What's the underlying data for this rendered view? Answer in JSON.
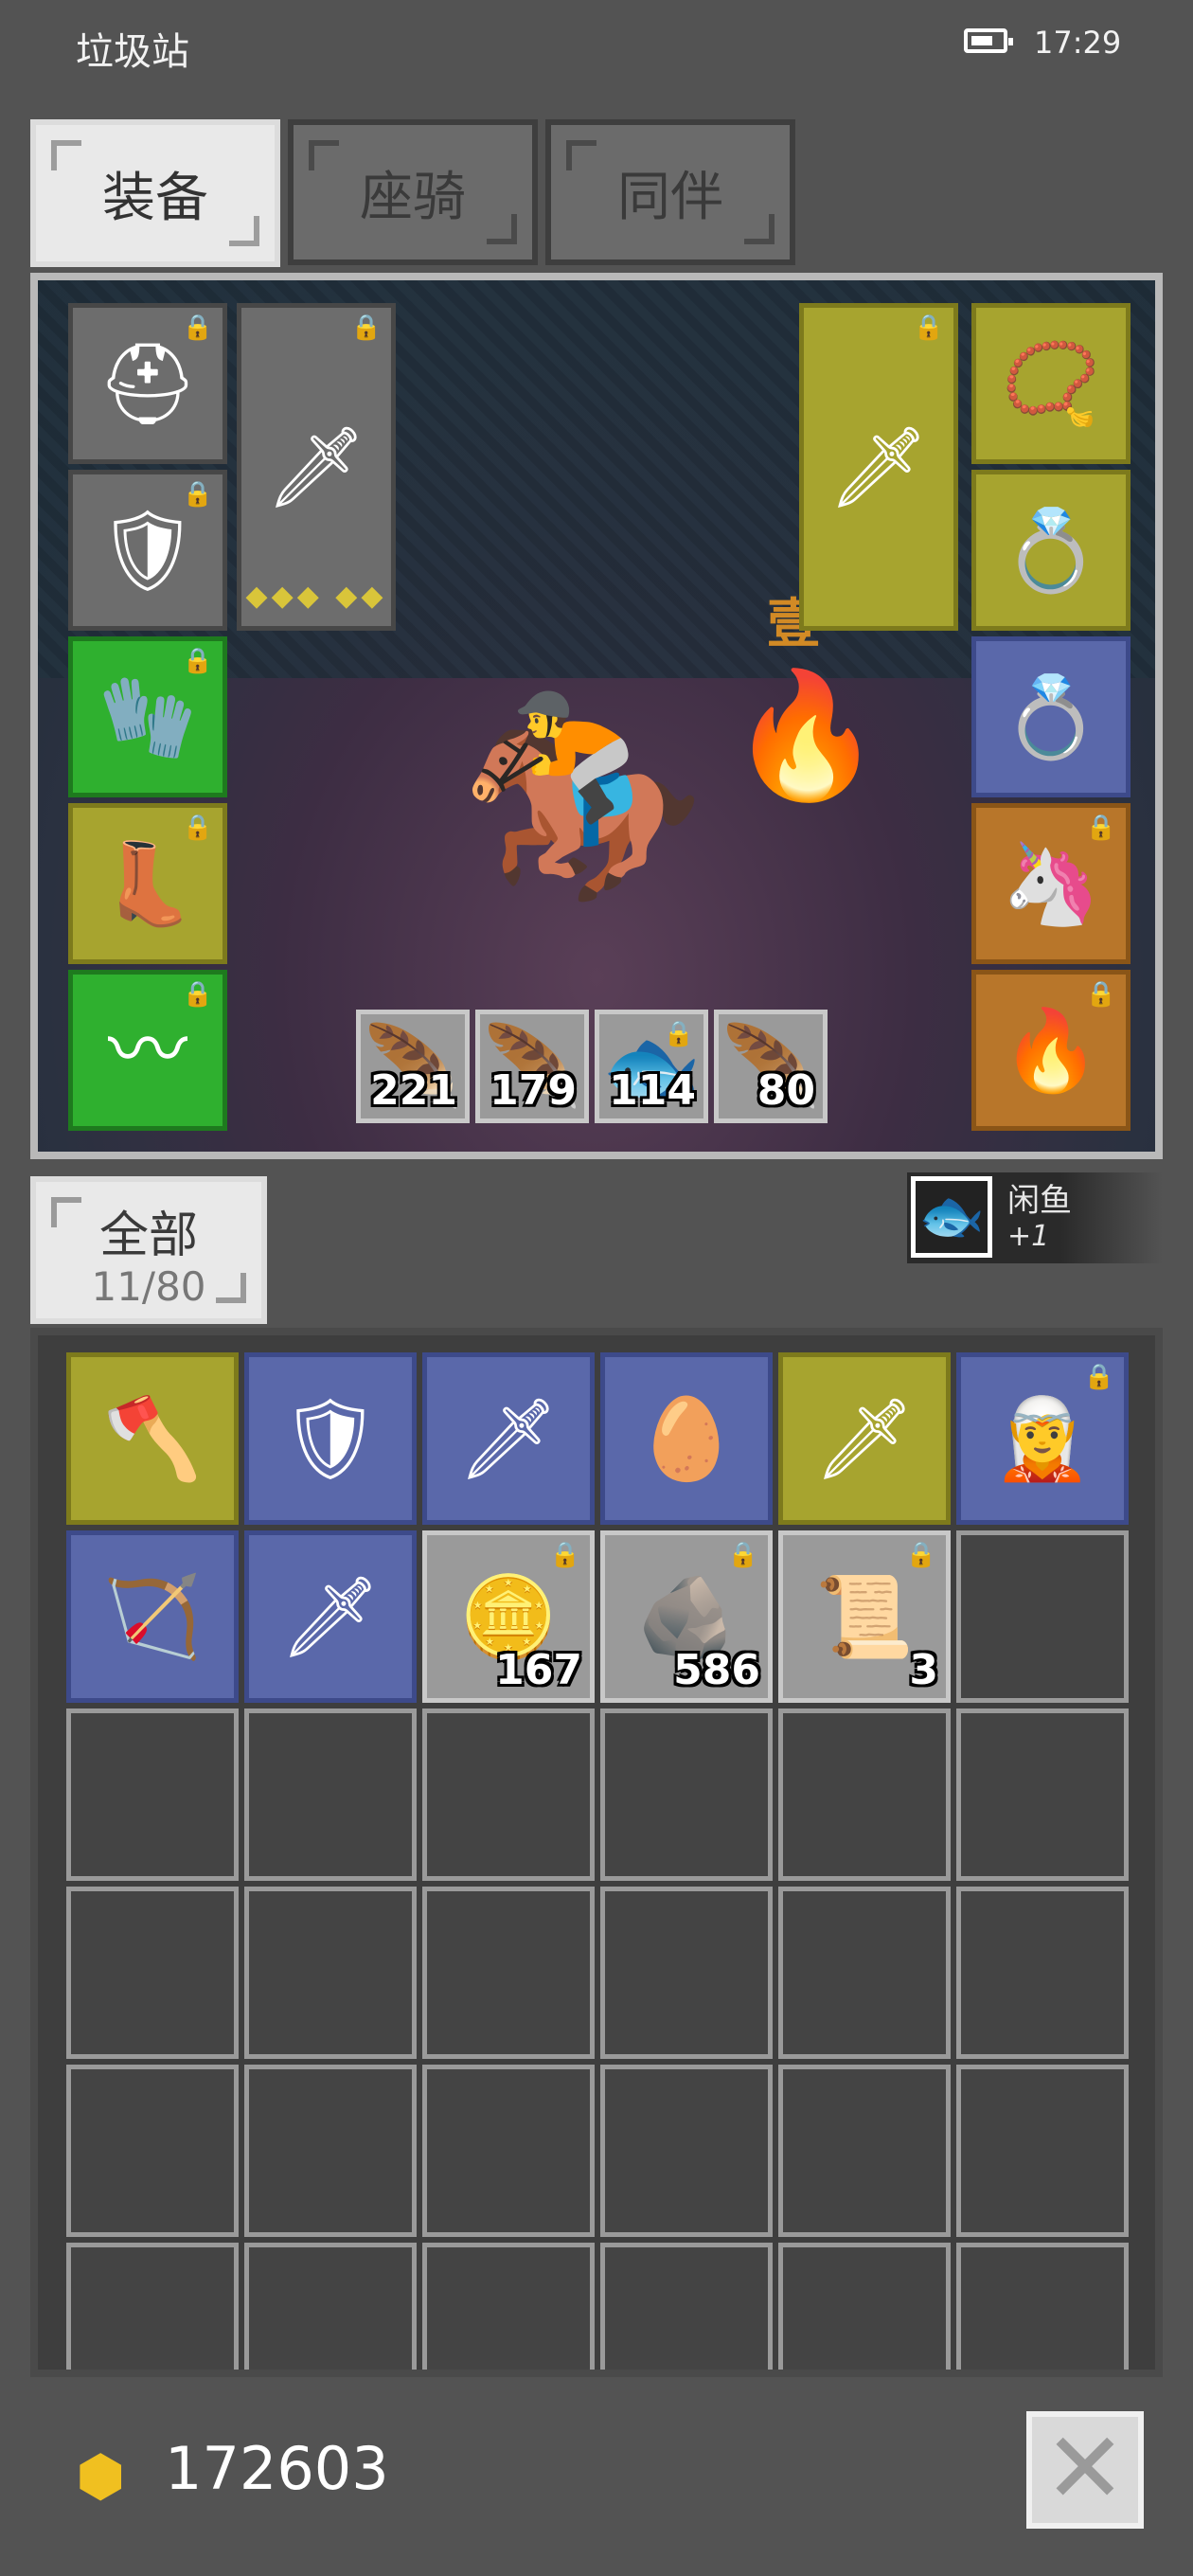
{
  "status_bar": {
    "app_title": "垃圾站",
    "time": "17:29"
  },
  "tabs": [
    {
      "label": "装备",
      "active": true
    },
    {
      "label": "座骑",
      "active": false
    },
    {
      "label": "同伴",
      "active": false
    }
  ],
  "scene": {
    "rank_label": "壹",
    "hero_icon": "mounted-knight",
    "pet_icon": "flame-spirit",
    "equip_left": [
      {
        "icon": "horned-helmet-icon",
        "glyph": "⛑",
        "rarity": "gray",
        "locked": true
      },
      {
        "icon": "dark-armor-icon",
        "glyph": "🛡",
        "rarity": "gray",
        "locked": true
      },
      {
        "icon": "crystal-gauntlet-icon",
        "glyph": "🧤",
        "rarity": "green",
        "locked": true
      },
      {
        "icon": "leather-boots-icon",
        "glyph": "👢",
        "rarity": "olive",
        "locked": true
      },
      {
        "icon": "crystal-belt-icon",
        "glyph": "〰",
        "rarity": "green",
        "locked": true
      }
    ],
    "weapon_slot": {
      "icon": "steel-sword-icon",
      "glyph": "🗡",
      "locked": true,
      "gems": "◆◆◆ ◆◆"
    },
    "offhand_slot": {
      "icon": "iron-sword-icon",
      "glyph": "🗡",
      "locked": true
    },
    "equip_right": [
      {
        "icon": "gold-necklace-icon",
        "glyph": "📿",
        "rarity": "olive",
        "locked": false
      },
      {
        "icon": "gold-ring-icon",
        "glyph": "💍",
        "rarity": "olive",
        "locked": false
      },
      {
        "icon": "gold-ring-icon",
        "glyph": "💍",
        "rarity": "blue",
        "locked": false
      },
      {
        "icon": "mount-unicorn-icon",
        "glyph": "🦄",
        "rarity": "orange",
        "locked": true
      },
      {
        "icon": "companion-flame-icon",
        "glyph": "🔥",
        "rarity": "orange",
        "locked": true
      }
    ],
    "consumables": [
      {
        "icon": "red-feather-icon",
        "glyph": "🪶",
        "count": "221",
        "locked": false
      },
      {
        "icon": "red-feather-icon",
        "glyph": "🪶",
        "count": "179",
        "locked": false
      },
      {
        "icon": "blue-fish-icon",
        "glyph": "🐟",
        "count": "114",
        "locked": true
      },
      {
        "icon": "blue-feather-icon",
        "glyph": "🪶",
        "count": "80",
        "locked": false
      }
    ]
  },
  "filter": {
    "label": "全部",
    "count": "11/80"
  },
  "notification": {
    "icon": "fish-icon",
    "glyph": "🐟",
    "item_name": "闲鱼",
    "quantity": "+1"
  },
  "inventory": [
    {
      "icon": "halberd-icon",
      "glyph": "🪓",
      "rarity": "olive",
      "locked": false
    },
    {
      "icon": "dark-armor-icon",
      "glyph": "🛡",
      "rarity": "blue",
      "locked": false
    },
    {
      "icon": "dagger-icon",
      "glyph": "🗡",
      "rarity": "blue",
      "locked": false
    },
    {
      "icon": "silver-egg-icon",
      "glyph": "🥚",
      "rarity": "blue",
      "locked": false
    },
    {
      "icon": "dagger-icon",
      "glyph": "🗡",
      "rarity": "olive",
      "locked": false
    },
    {
      "icon": "warrior-portrait-icon",
      "glyph": "🧝",
      "rarity": "blue",
      "locked": true
    },
    {
      "icon": "bow-icon",
      "glyph": "🏹",
      "rarity": "blue",
      "locked": false
    },
    {
      "icon": "dagger-icon",
      "glyph": "🗡",
      "rarity": "blue",
      "locked": false
    },
    {
      "icon": "gold-ore-icon",
      "glyph": "🪙",
      "rarity": "light",
      "locked": true,
      "count": "167"
    },
    {
      "icon": "copper-ore-icon",
      "glyph": "🪨",
      "rarity": "light",
      "locked": true,
      "count": "586"
    },
    {
      "icon": "scroll-icon",
      "glyph": "📜",
      "rarity": "light",
      "locked": true,
      "count": "3"
    }
  ],
  "inventory_total_slots": 36,
  "gold": {
    "icon": "gold-pile-icon",
    "value": "172603"
  },
  "close_button": {
    "glyph": "✕"
  }
}
